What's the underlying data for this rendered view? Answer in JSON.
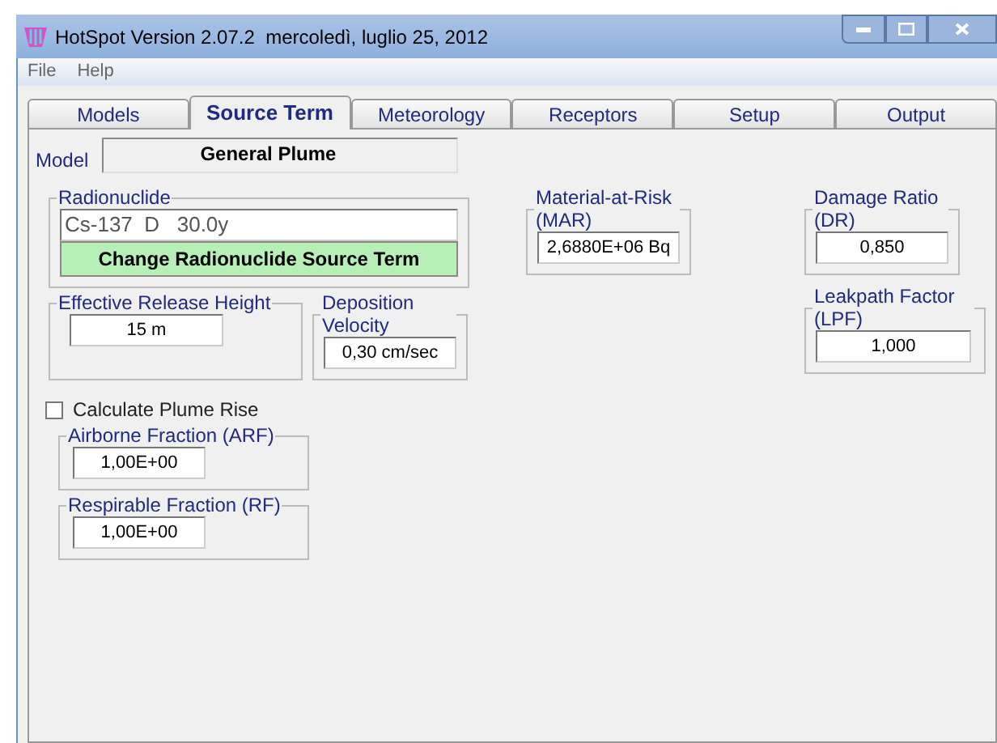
{
  "window": {
    "title": "HotSpot Version 2.07.2  mercoledì, luglio 25, 2012"
  },
  "menu": [
    "File",
    "Help"
  ],
  "tabs": [
    {
      "label": "Models",
      "selected": false
    },
    {
      "label": "Source Term",
      "selected": true
    },
    {
      "label": "Meteorology",
      "selected": false
    },
    {
      "label": "Receptors",
      "selected": false
    },
    {
      "label": "Setup",
      "selected": false
    },
    {
      "label": "Output",
      "selected": false
    }
  ],
  "model": {
    "label": "Model",
    "value": "General Plume"
  },
  "radionuclide": {
    "label": "Radionuclide",
    "value": "Cs-137  D   30.0y",
    "button": "Change Radionuclide Source Term"
  },
  "release_height": {
    "label": "Effective Release Height",
    "value": "15 m"
  },
  "deposition_velocity": {
    "label": "Deposition Velocity",
    "value": "0,30 cm/sec"
  },
  "plume_rise": {
    "label": "Calculate Plume Rise",
    "checked": false
  },
  "airborne_fraction": {
    "label": "Airborne Fraction (ARF)",
    "value": "1,00E+00"
  },
  "respirable_fraction": {
    "label": "Respirable Fraction (RF)",
    "value": "1,00E+00"
  },
  "material_at_risk": {
    "label": "Material-at-Risk (MAR)",
    "value": "2,6880E+06 Bq"
  },
  "damage_ratio": {
    "label": "Damage Ratio (DR)",
    "value": "0,850"
  },
  "leakpath_factor": {
    "label": "Leakpath Factor (LPF)",
    "value": "1,000"
  }
}
